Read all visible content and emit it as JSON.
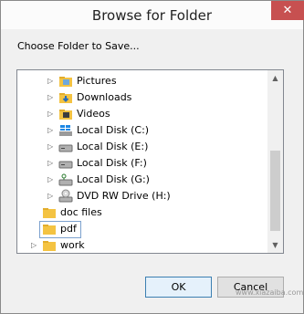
{
  "window": {
    "title": "Browse for Folder",
    "close_glyph": "✕"
  },
  "prompt": "Choose Folder to Save...",
  "tree": [
    {
      "label": "Pictures",
      "icon": "pictures-folder-icon",
      "expandable": true,
      "selected": false
    },
    {
      "label": "Downloads",
      "icon": "downloads-folder-icon",
      "expandable": true,
      "selected": false
    },
    {
      "label": "Videos",
      "icon": "videos-folder-icon",
      "expandable": true,
      "selected": false
    },
    {
      "label": "Local Disk (C:)",
      "icon": "windows-drive-icon",
      "expandable": true,
      "selected": false
    },
    {
      "label": "Local Disk (E:)",
      "icon": "hard-drive-icon",
      "expandable": true,
      "selected": false
    },
    {
      "label": "Local Disk (F:)",
      "icon": "hard-drive-icon",
      "expandable": true,
      "selected": false
    },
    {
      "label": "Local Disk (G:)",
      "icon": "usb-drive-icon",
      "expandable": true,
      "selected": false
    },
    {
      "label": "DVD RW Drive (H:)",
      "icon": "dvd-drive-icon",
      "expandable": true,
      "selected": false
    },
    {
      "label": "doc files",
      "icon": "folder-icon",
      "expandable": false,
      "selected": false
    },
    {
      "label": "pdf",
      "icon": "folder-icon",
      "expandable": false,
      "selected": true
    },
    {
      "label": "work",
      "icon": "folder-icon",
      "expandable": true,
      "selected": false
    }
  ],
  "buttons": {
    "ok": "OK",
    "cancel": "Cancel"
  },
  "watermark": "www.xiazaiba.com",
  "colors": {
    "selection_border": "#7da2ce",
    "folder": "#f4c342",
    "close": "#c75050"
  }
}
